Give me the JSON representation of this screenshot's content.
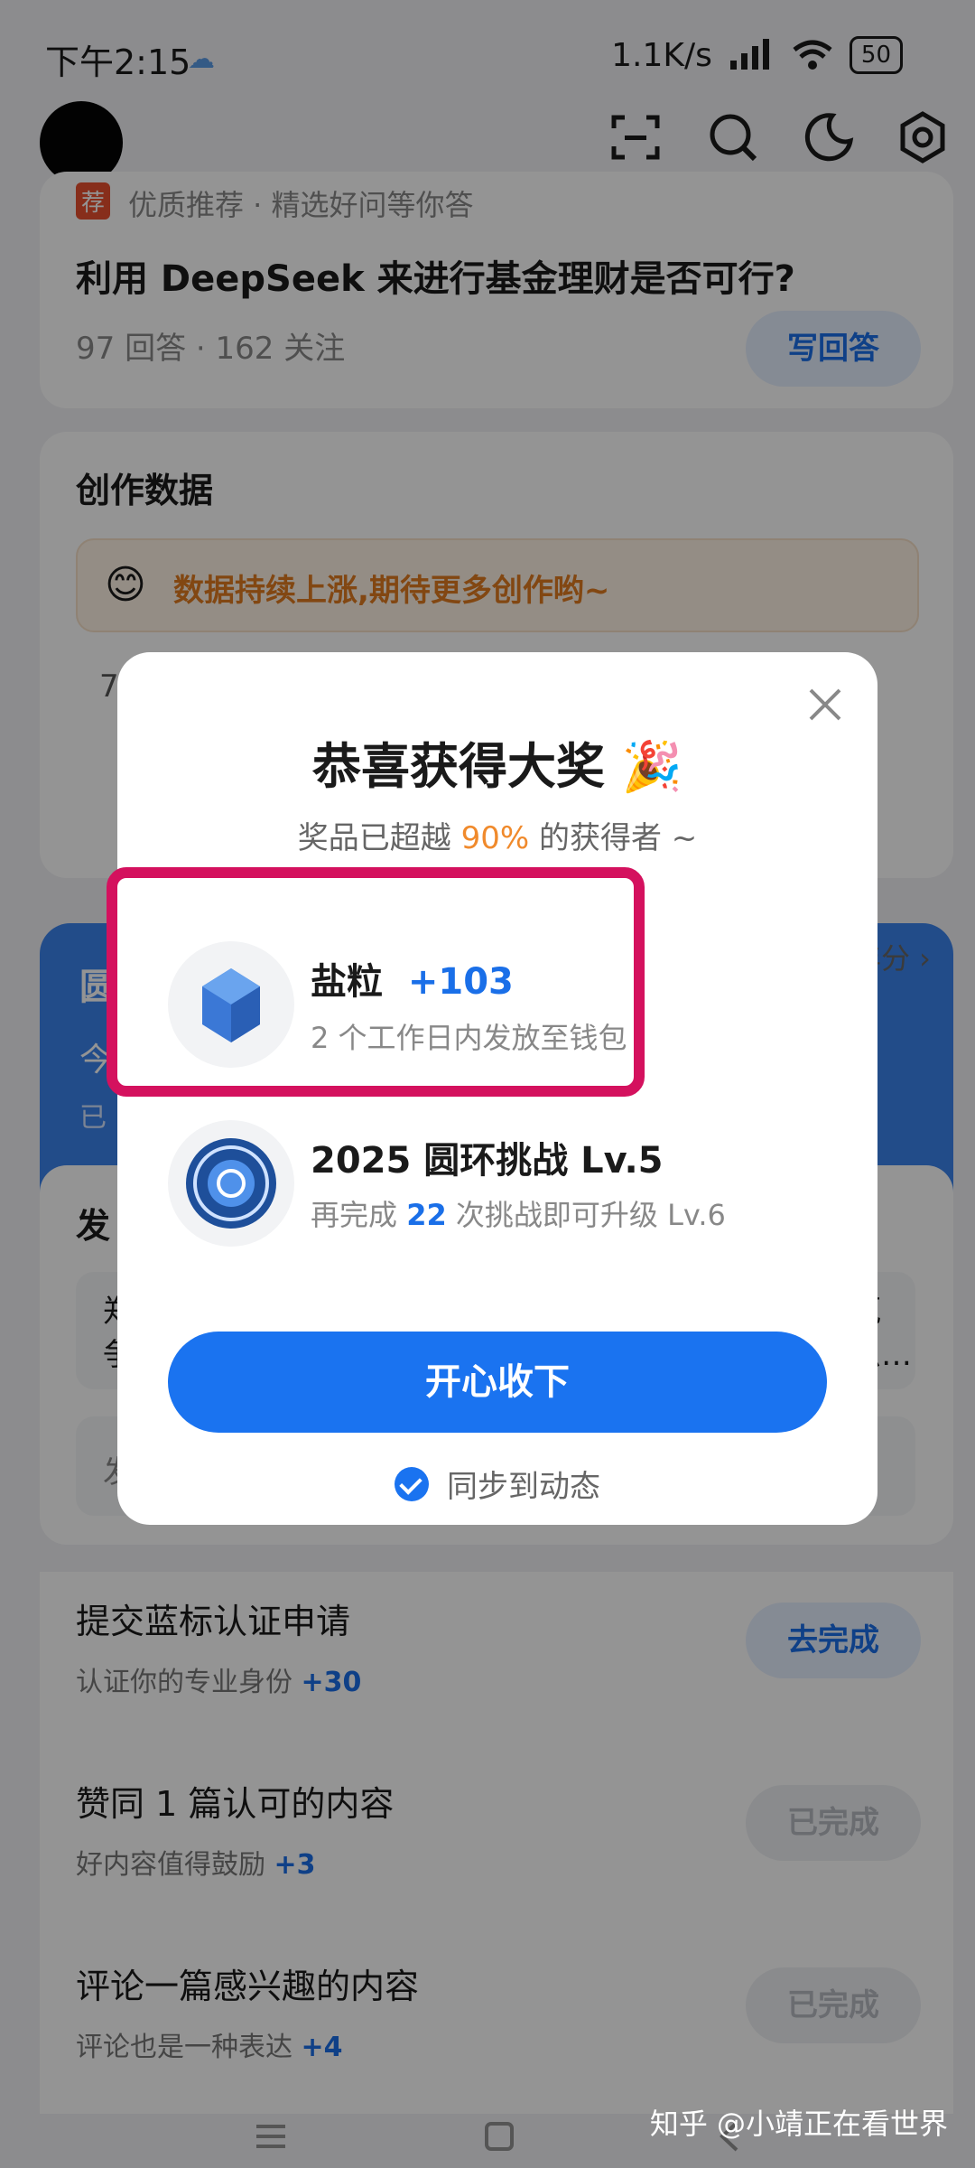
{
  "status": {
    "time": "下午2:15",
    "speed": "1.1K/s",
    "battery": "50"
  },
  "question_card": {
    "tag_badge": "荐",
    "tag_text": "优质推荐 · 精选好问等你答",
    "title": "利用 DeepSeek 来进行基金理财是否可行?",
    "meta": "97 回答 · 162 关注",
    "button": "写回答"
  },
  "creation": {
    "title": "创作数据",
    "banner": "数据持续上涨,期待更多创作哟~",
    "partial_value": "7"
  },
  "background_partial": {
    "left_char_1": "圆",
    "left_char_2": "今",
    "left_char_3": "已",
    "right_text": "年分 ›",
    "section_left": "发",
    "row_left_1": "郑",
    "row_left_2": "争",
    "row_right_1": "蒐",
    "row_right_2": "么…",
    "row_left_3": "发"
  },
  "modal": {
    "title": "恭喜获得大奖 🎉",
    "subtitle_prefix": "奖品已超越 ",
    "subtitle_pct": "90%",
    "subtitle_suffix": " 的获得者 ~",
    "rewards": [
      {
        "name": "盐粒",
        "amount": "+103",
        "desc": "2 个工作日内发放至钱包"
      },
      {
        "name": "2025 圆环挑战 Lv.5",
        "desc_prefix": "再完成 ",
        "desc_num": "22",
        "desc_suffix": " 次挑战即可升级 Lv.6"
      }
    ],
    "cta": "开心收下",
    "sync_label": "同步到动态"
  },
  "tasks": [
    {
      "title": "提交蓝标认证申请",
      "sub": "认证你的专业身份 ",
      "points": "+30",
      "button": "去完成"
    },
    {
      "title": "赞同 1 篇认可的内容",
      "sub": "好内容值得鼓励 ",
      "points": "+3",
      "button": "已完成"
    },
    {
      "title": "评论一篇感兴趣的内容",
      "sub": "评论也是一种表达 ",
      "points": "+4",
      "button": "已完成"
    }
  ],
  "watermark": "知乎 @小靖正在看世界",
  "colors": {
    "accent": "#1a73f0",
    "highlight": "#d4115e",
    "orange": "#f08a2c"
  }
}
